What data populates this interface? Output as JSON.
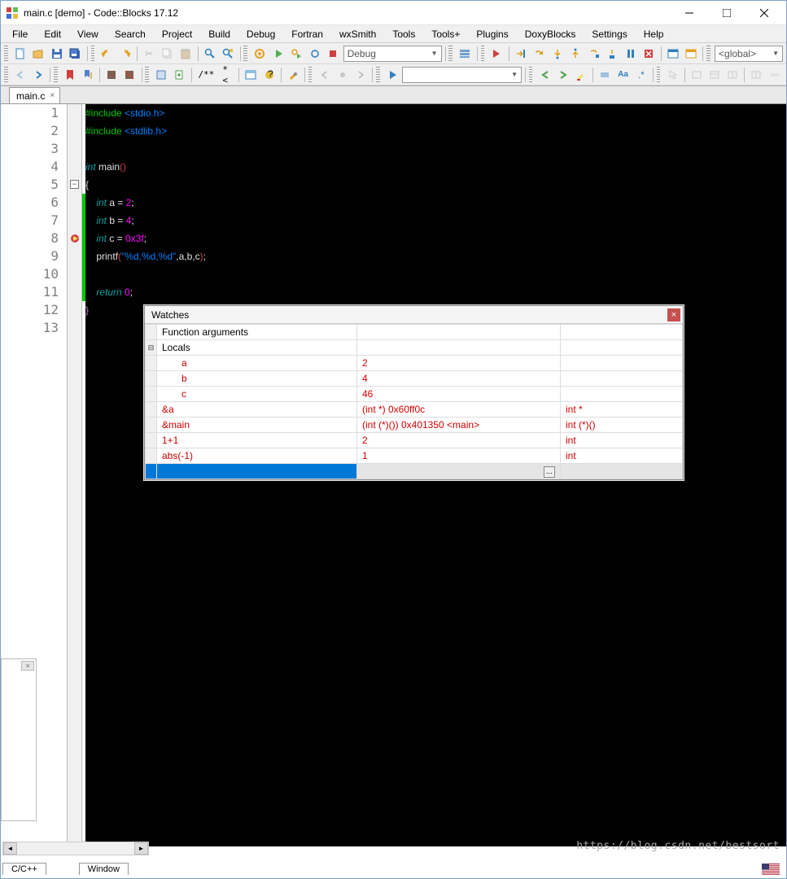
{
  "window": {
    "title": "main.c [demo] - Code::Blocks 17.12"
  },
  "menu": {
    "file": "File",
    "edit": "Edit",
    "view": "View",
    "search": "Search",
    "project": "Project",
    "build": "Build",
    "debug": "Debug",
    "fortran": "Fortran",
    "wxsmith": "wxSmith",
    "tools": "Tools",
    "toolsplus": "Tools+",
    "plugins": "Plugins",
    "doxyblocks": "DoxyBlocks",
    "settings": "Settings",
    "help": "Help"
  },
  "toolbar": {
    "config": "Debug",
    "scope": "<global>",
    "doxy1": "/**",
    "doxy2": "*<"
  },
  "tab": {
    "label": "main.c"
  },
  "code": {
    "lines": [
      "1",
      "2",
      "3",
      "4",
      "5",
      "6",
      "7",
      "8",
      "9",
      "10",
      "11",
      "12",
      "13"
    ],
    "l1a": "#include",
    "l1b": " <stdio.h>",
    "l2a": "#include",
    "l2b": " <stdlib.h>",
    "l4a": "int",
    "l4b": " main",
    "l4c": "()",
    "l5": "{",
    "l6a": "int",
    "l6b": " a ",
    "l6c": "=",
    "l6d": " 2",
    "l6e": ";",
    "l7a": "int",
    "l7b": " b ",
    "l7c": "=",
    "l7d": " 4",
    "l7e": ";",
    "l8a": "int",
    "l8b": " c ",
    "l8c": "=",
    "l8d": " 0x3f",
    "l8e": ";",
    "l9a": "printf",
    "l9b": "(",
    "l9c": "\"%d,%d,%d\"",
    "l9d": ",a,b,c",
    "l9e": ")",
    "l9f": ";",
    "l11a": "return",
    "l11b": " 0",
    "l11c": ";",
    "l12": "}"
  },
  "watches": {
    "title": "Watches",
    "hdr1": "Function arguments",
    "hdr2": "Locals",
    "rows": [
      {
        "name": "a",
        "val": "2",
        "type": ""
      },
      {
        "name": "b",
        "val": "4",
        "type": ""
      },
      {
        "name": "c",
        "val": "46",
        "type": ""
      }
    ],
    "custom": [
      {
        "name": "&a",
        "val": "(int *) 0x60ff0c",
        "type": "int *"
      },
      {
        "name": "&main",
        "val": "(int (*)()) 0x401350 <main>",
        "type": "int (*)()"
      },
      {
        "name": "1+1",
        "val": "2",
        "type": "int"
      },
      {
        "name": "abs(-1)",
        "val": "1",
        "type": "int"
      }
    ],
    "ellipsis": "..."
  },
  "bottom": {
    "lang": "C/C++",
    "windows": "Window"
  },
  "watermark": "https://blog.csdn.net/bestsort"
}
